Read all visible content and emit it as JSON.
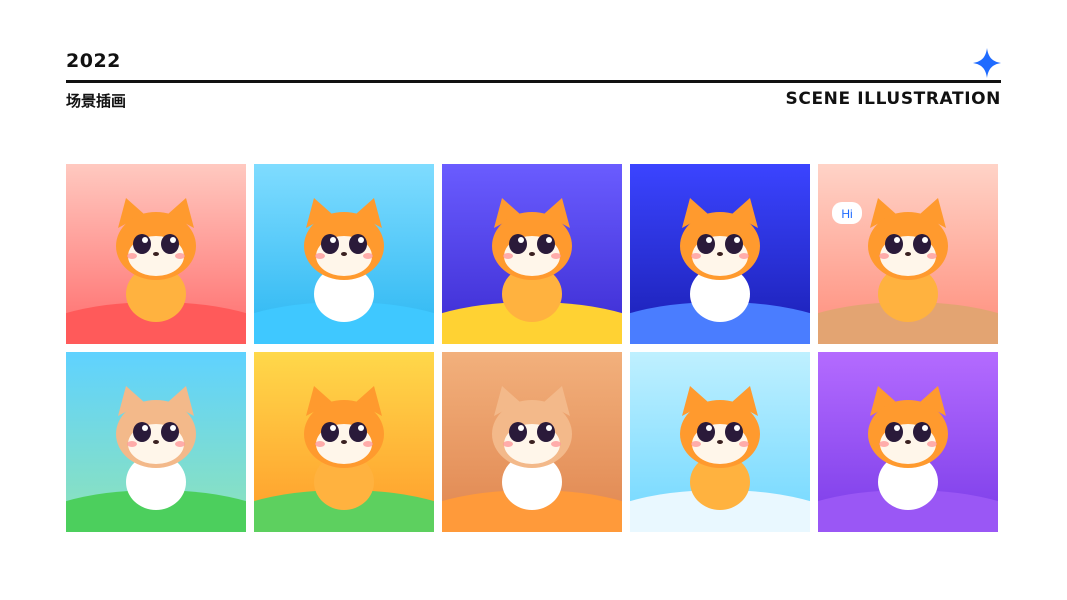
{
  "header": {
    "year": "2022",
    "subtitle_cn": "场景插画",
    "subtitle_en": "SCENE ILLUSTRATION"
  },
  "colors": {
    "accent": "#1f6bff",
    "text": "#111111"
  },
  "tiles": [
    {
      "scene": "go-board-garden",
      "bg_top": "#ffc9c0",
      "bg_bottom": "#ff6b6b",
      "ground": "#ff5a5a"
    },
    {
      "scene": "sailing-boat",
      "bg_top": "#7fdcff",
      "bg_bottom": "#2ab6f2",
      "ground": "#3fc8ff"
    },
    {
      "scene": "laptop-study",
      "bg_top": "#6a5cff",
      "bg_bottom": "#3b2bd1",
      "ground": "#ffd233"
    },
    {
      "scene": "astronaut-space",
      "bg_top": "#3b44ff",
      "bg_bottom": "#1a1fb3",
      "ground": "#4a7dff"
    },
    {
      "scene": "stage-curtain",
      "bg_top": "#ffd3c7",
      "bg_bottom": "#ff8c7a",
      "ground": "#e3a472",
      "bubble": "Hi"
    },
    {
      "scene": "camping-tent",
      "bg_top": "#5fd2ff",
      "bg_bottom": "#8fe3b8",
      "ground": "#4ccf5d"
    },
    {
      "scene": "graduation-day",
      "bg_top": "#ffd84a",
      "bg_bottom": "#ff9b2a",
      "ground": "#5dd05f"
    },
    {
      "scene": "classroom-blackboard",
      "bg_top": "#f2b07c",
      "bg_bottom": "#e0864f",
      "ground": "#ff9a3a"
    },
    {
      "scene": "math-tools",
      "bg_top": "#bff0ff",
      "bg_bottom": "#6fd7ff",
      "ground": "#e9f8ff"
    },
    {
      "scene": "balloon-basket",
      "bg_top": "#b46bff",
      "bg_bottom": "#7a3ce8",
      "ground": "#9a57f5"
    }
  ]
}
